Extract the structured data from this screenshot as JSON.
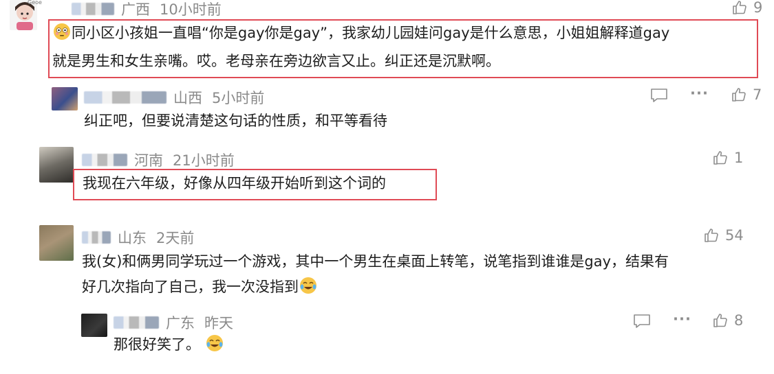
{
  "comments": [
    {
      "location": "广西",
      "time": "10小时前",
      "likes": "9",
      "text_lines": [
        "同小区小孩姐一直唱“你是gay你是gay”，我家幼儿园娃问gay是什么意思，小姐姐解释道gay",
        "就是男生和女生亲嘴。哎。老母亲在旁边欲言又止。纠正还是沉默啊。"
      ],
      "avatar_badge": "Geoe",
      "leading_emoji": "flushed-face"
    },
    {
      "location": "山西",
      "time": "5小时前",
      "likes": "7",
      "text": "纠正吧，但要说清楚这句话的性质，和平等看待"
    },
    {
      "location": "河南",
      "time": "21小时前",
      "likes": "1",
      "text": "我现在六年级，好像从四年级开始听到这个词的"
    },
    {
      "location": "山东",
      "time": "2天前",
      "likes": "54",
      "text_lines": [
        "我(女)和俩男同学玩过一个游戏，其中一个男生在桌面上转笔，说笔指到谁谁是gay，结果有",
        "好几次指向了自己，我一次没指到"
      ],
      "trailing_emoji": "tears-of-joy"
    },
    {
      "location": "广东",
      "time": "昨天",
      "likes": "8",
      "text": "那很好笑了。",
      "trailing_emoji": "tears-of-joy"
    }
  ],
  "ui": {
    "more_label": "···"
  },
  "colors": {
    "highlight_border": "#e04a55",
    "meta_text": "#8a8a8a",
    "body_text": "#1d1d1d"
  }
}
